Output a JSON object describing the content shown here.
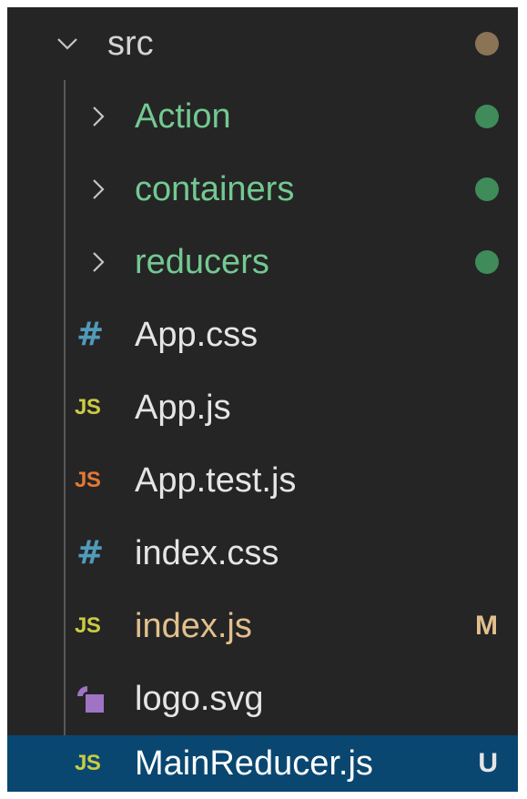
{
  "explorer": {
    "root": {
      "label": "src",
      "expanded": true,
      "decoration_color": "#8b7355"
    },
    "items": [
      {
        "type": "folder",
        "label": "Action",
        "decoration_color": "#3f8b59"
      },
      {
        "type": "folder",
        "label": "containers",
        "decoration_color": "#3f8b59"
      },
      {
        "type": "folder",
        "label": "reducers",
        "decoration_color": "#3f8b59"
      },
      {
        "type": "file",
        "label": "App.css",
        "icon": "css-hash-icon",
        "icon_text": "#",
        "icon_color": "#519aba"
      },
      {
        "type": "file",
        "label": "App.js",
        "icon": "javascript-icon",
        "icon_text": "JS",
        "icon_color": "#cbcb41"
      },
      {
        "type": "file",
        "label": "App.test.js",
        "icon": "javascript-test-icon",
        "icon_text": "JS",
        "icon_color": "#e37933"
      },
      {
        "type": "file",
        "label": "index.css",
        "icon": "css-hash-icon",
        "icon_text": "#",
        "icon_color": "#519aba"
      },
      {
        "type": "file",
        "label": "index.js",
        "icon": "javascript-icon",
        "icon_text": "JS",
        "icon_color": "#cbcb41",
        "badge": "M"
      },
      {
        "type": "file",
        "label": "logo.svg",
        "icon": "svg-image-icon",
        "icon_color": "#a074c4"
      },
      {
        "type": "file",
        "label": "MainReducer.js",
        "icon": "javascript-icon",
        "icon_text": "JS",
        "icon_color": "#cbcb41",
        "badge": "U",
        "selected": true
      }
    ]
  },
  "colors": {
    "background": "#252526",
    "selection": "#094771",
    "folder_modified": "#73c991",
    "badge_modified": "#e2c08d"
  }
}
